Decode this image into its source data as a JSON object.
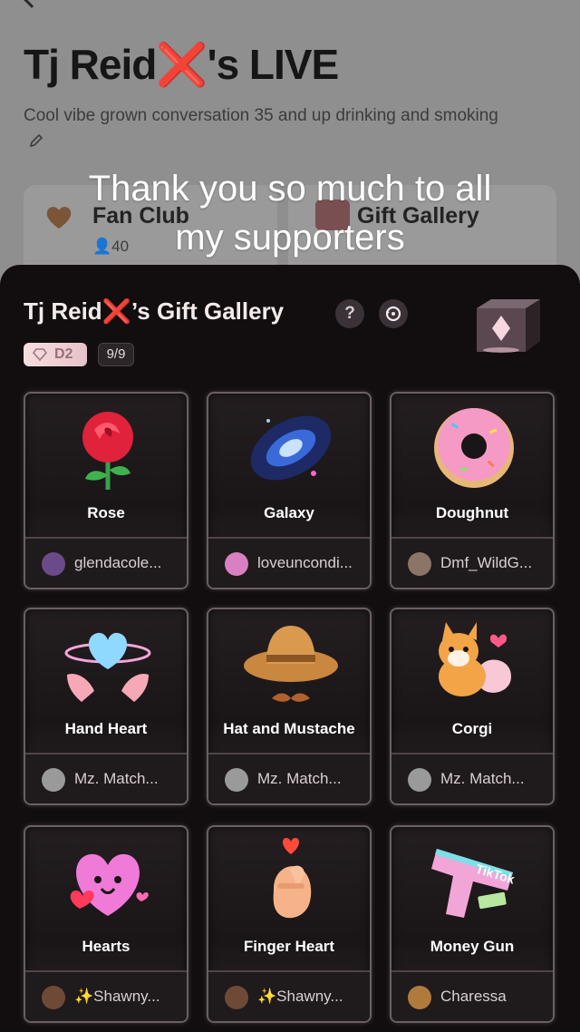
{
  "background": {
    "title_name": "Tj Reid",
    "title_x": "❌",
    "title_suffix": "'s LIVE",
    "description": "Cool vibe grown conversation 35 and up drinking and smoking",
    "fan_club_label": "Fan Club",
    "fan_club_count": "40",
    "gift_gallery_label": "Gift Gallery"
  },
  "overlay_caption": [
    "Thank you so much to all",
    "my supporters"
  ],
  "sheet": {
    "title_name": "Tj Reid",
    "title_x": "❌",
    "title_suffix": "’s Gift Gallery",
    "help_label": "?",
    "level_badge": "D2",
    "progress": "9/9"
  },
  "gifts": [
    {
      "name": "Rose",
      "sender": "glendacole...",
      "icon": "rose-icon"
    },
    {
      "name": "Galaxy",
      "sender": "loveuncondi...",
      "icon": "galaxy-icon"
    },
    {
      "name": "Doughnut",
      "sender": "Dmf_WildG...",
      "icon": "doughnut-icon"
    },
    {
      "name": "Hand Heart",
      "sender": "Mz. Match...",
      "icon": "hand-heart-icon"
    },
    {
      "name": "Hat and Mustache",
      "sender": "Mz. Match...",
      "icon": "hat-icon"
    },
    {
      "name": "Corgi",
      "sender": "Mz. Match...",
      "icon": "corgi-icon"
    },
    {
      "name": "Hearts",
      "sender": "✨Shawny...",
      "icon": "hearts-icon"
    },
    {
      "name": "Finger Heart",
      "sender": "✨Shawny...",
      "icon": "finger-heart-icon"
    },
    {
      "name": "Money Gun",
      "sender": "Charessa",
      "icon": "money-gun-icon"
    }
  ],
  "colors": {
    "sheet_bg": "#120d0f",
    "accent_x": "#d61a1a"
  }
}
